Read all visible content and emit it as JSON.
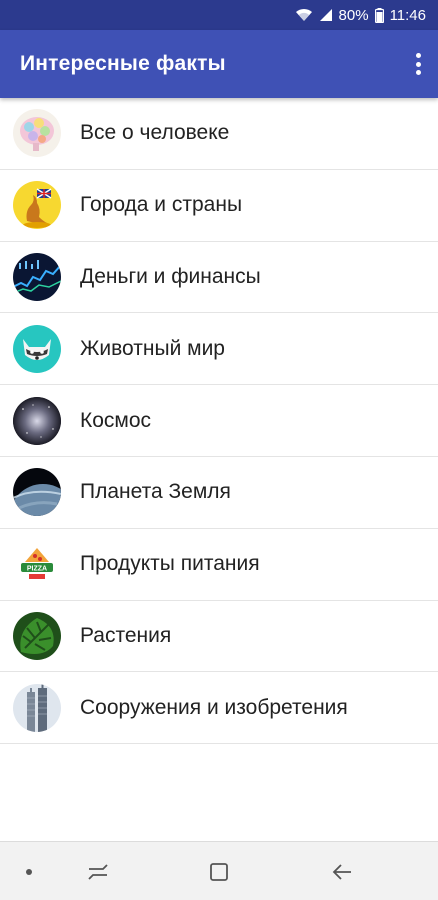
{
  "status_bar": {
    "battery_percent": "80%",
    "time": "11:46",
    "icons": [
      "wifi-icon",
      "signal-icon",
      "battery-icon"
    ]
  },
  "app_bar": {
    "title": "Интересные факты",
    "menu_icon": "overflow-menu-icon"
  },
  "categories": [
    {
      "label": "Все о человеке",
      "icon": "brain-icon"
    },
    {
      "label": "Города и страны",
      "icon": "kangaroo-australia-icon"
    },
    {
      "label": "Деньги и финансы",
      "icon": "stock-chart-icon"
    },
    {
      "label": "Животный мир",
      "icon": "raccoon-icon"
    },
    {
      "label": "Космос",
      "icon": "galaxy-icon"
    },
    {
      "label": "Планета Земля",
      "icon": "earth-icon"
    },
    {
      "label": "Продукты питания",
      "icon": "pizza-icon"
    },
    {
      "label": "Растения",
      "icon": "monstera-leaf-icon"
    },
    {
      "label": "Сооружения и изобретения",
      "icon": "skyscraper-icon"
    }
  ],
  "nav_bar": {
    "buttons": [
      "dot-icon",
      "recent-apps-icon",
      "home-icon",
      "back-icon"
    ]
  },
  "colors": {
    "status_bar": "#2c3a8e",
    "app_bar": "#3f51b5",
    "divider": "#e4e4e4"
  }
}
